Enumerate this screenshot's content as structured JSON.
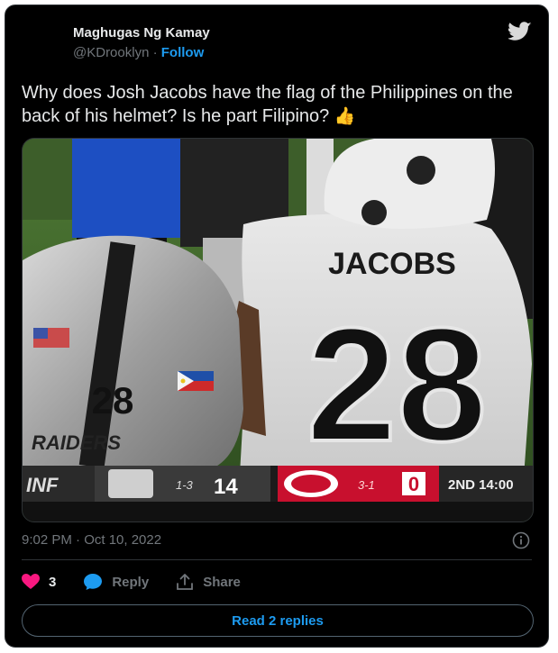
{
  "author": {
    "name": "Maghugas Ng Kamay",
    "handle": "@KDrooklyn",
    "separator": "·",
    "follow_label": "Follow"
  },
  "tweet": {
    "text": "Why does Josh Jacobs have the flag of the Philippines on the back of his helmet? Is he part Filipino? ",
    "emoji": "👍",
    "timestamp": "9:02 PM · Oct 10, 2022"
  },
  "image": {
    "jersey_name": "JACOBS",
    "jersey_number": "28",
    "helmet_number": "28",
    "helmet_text": "RAIDERS",
    "scorebug": {
      "network": "INF",
      "away_record": "1-3",
      "away_score": "14",
      "home_record": "3-1",
      "home_score": "0",
      "quarter_clock": "2ND 14:00"
    }
  },
  "actions": {
    "like_count": "3",
    "reply_label": "Reply",
    "share_label": "Share"
  },
  "read_replies_label": "Read 2 replies",
  "colors": {
    "background": "#000000",
    "text": "#e7e9ea",
    "muted": "#71767b",
    "accent": "#1d9bf0",
    "like": "#f91880"
  },
  "icons": [
    "twitter-bird-icon",
    "info-icon",
    "heart-icon",
    "reply-bubble-icon",
    "share-icon"
  ]
}
